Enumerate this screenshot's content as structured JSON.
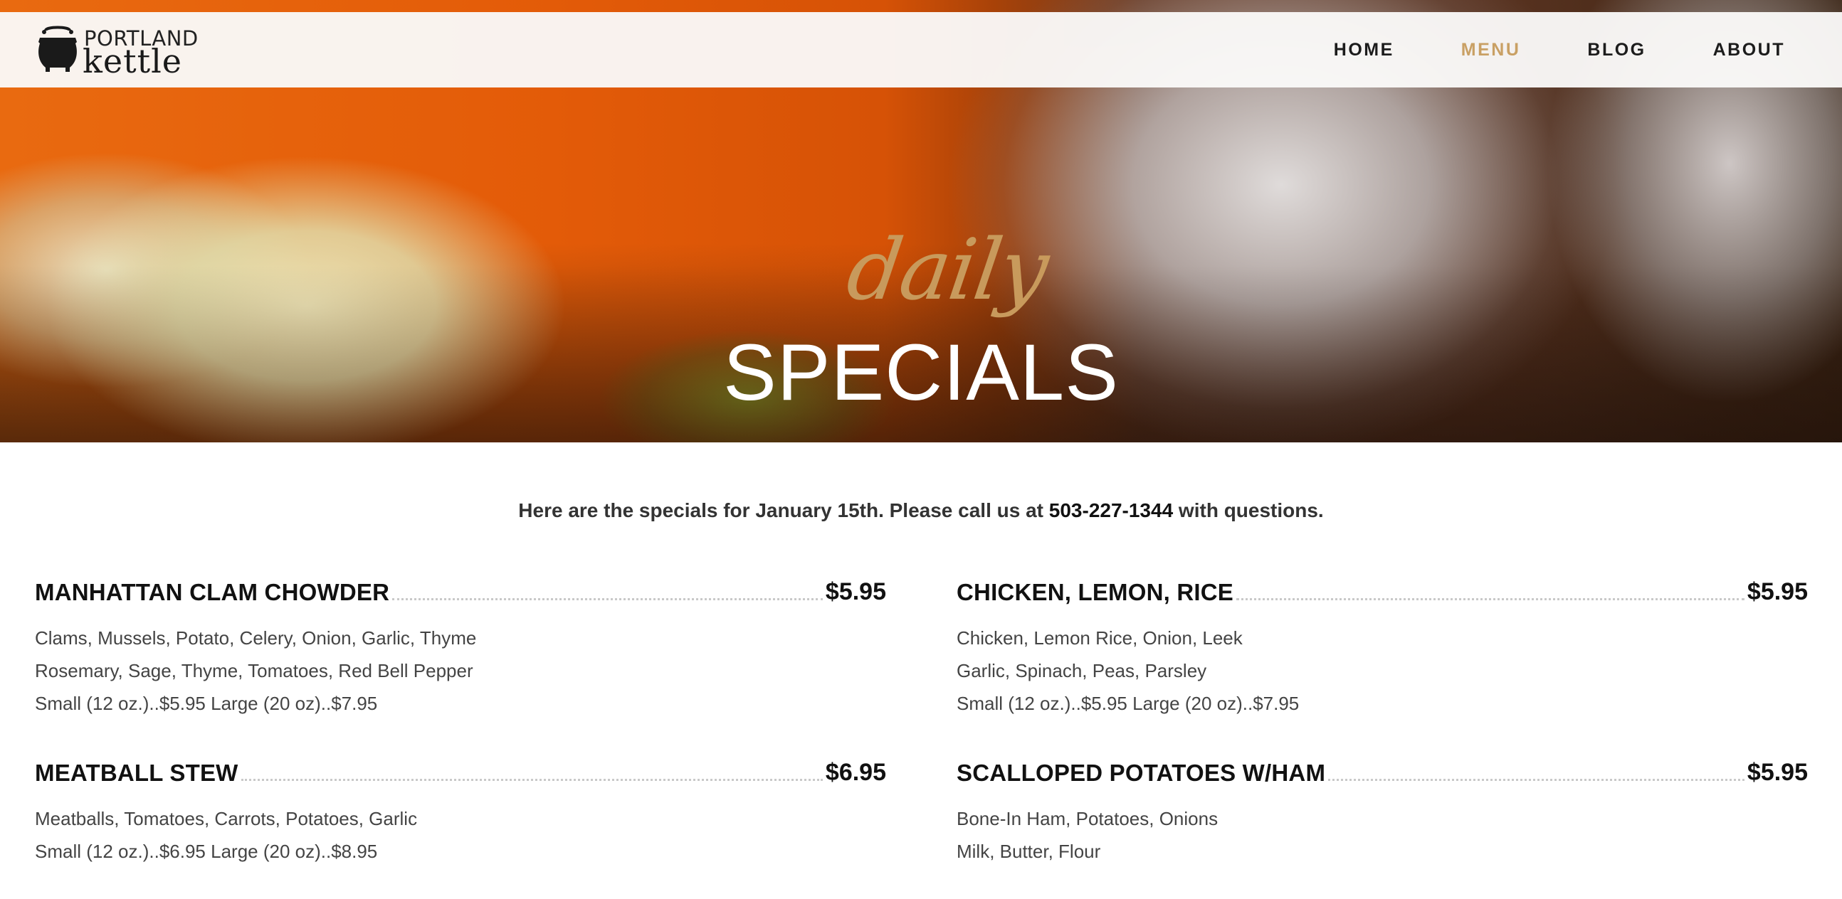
{
  "brand": {
    "logo_top": "PORTLAND",
    "logo_bottom": "kettle",
    "logo_icon": "kettle-pot-icon"
  },
  "nav": {
    "items": [
      {
        "label": "HOME",
        "active": false
      },
      {
        "label": "MENU",
        "active": true
      },
      {
        "label": "BLOG",
        "active": false
      },
      {
        "label": "ABOUT",
        "active": false
      }
    ],
    "active_color": "#c9a064"
  },
  "hero": {
    "script": "daily",
    "title": "SPECIALS",
    "script_color": "#c89a5c"
  },
  "intro": {
    "before": "Here are the specials for January 15th. Please call us at ",
    "phone": "503-227-1344",
    "after": " with questions."
  },
  "menu": {
    "items": [
      {
        "name": "MANHATTAN CLAM CHOWDER",
        "price": "$5.95",
        "lines": [
          "Clams, Mussels, Potato, Celery, Onion, Garlic, Thyme",
          "Rosemary, Sage, Thyme, Tomatoes, Red Bell Pepper",
          "Small (12 oz.)..$5.95 Large (20 oz)..$7.95"
        ]
      },
      {
        "name": "CHICKEN, LEMON, RICE",
        "price": "$5.95",
        "lines": [
          "Chicken, Lemon Rice, Onion, Leek",
          "Garlic, Spinach, Peas, Parsley",
          "Small (12 oz.)..$5.95 Large (20 oz)..$7.95"
        ]
      },
      {
        "name": "MEATBALL STEW",
        "price": "$6.95",
        "lines": [
          "Meatballs, Tomatoes, Carrots, Potatoes, Garlic",
          "Small (12 oz.)..$6.95 Large (20 oz)..$8.95"
        ]
      },
      {
        "name": "SCALLOPED POTATOES W/HAM",
        "price": "$5.95",
        "lines": [
          "Bone-In Ham, Potatoes, Onions",
          "Milk, Butter, Flour"
        ]
      }
    ]
  }
}
